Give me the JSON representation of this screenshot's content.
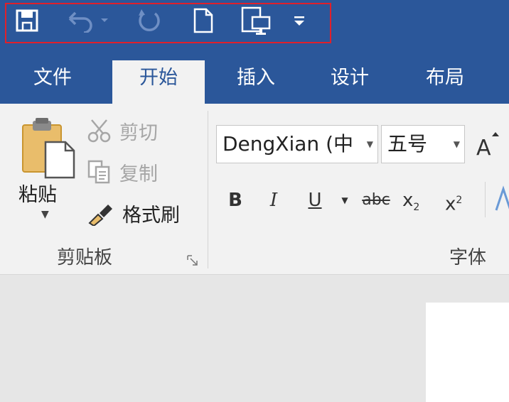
{
  "colors": {
    "accent": "#2b579a",
    "highlight": "#e0202a",
    "ribbon": "#f2f2f2"
  },
  "qat": {
    "icons": [
      "save-icon",
      "undo-icon",
      "redo-icon",
      "new-document-icon",
      "touch-mode-icon",
      "customize-dropdown-icon"
    ]
  },
  "tabs": [
    "文件",
    "开始",
    "插入",
    "设计",
    "布局"
  ],
  "clipboard": {
    "paste_label": "粘贴",
    "cut_label": "剪切",
    "copy_label": "复制",
    "format_painter_label": "格式刷",
    "group_label": "剪贴板"
  },
  "font": {
    "font_name": "DengXian (中",
    "font_size": "五号",
    "bold": "B",
    "italic": "I",
    "underline": "U",
    "strikethrough": "abc",
    "subscript": "x",
    "subscript_mark": "2",
    "superscript": "x",
    "superscript_mark": "2",
    "group_label": "字体"
  }
}
